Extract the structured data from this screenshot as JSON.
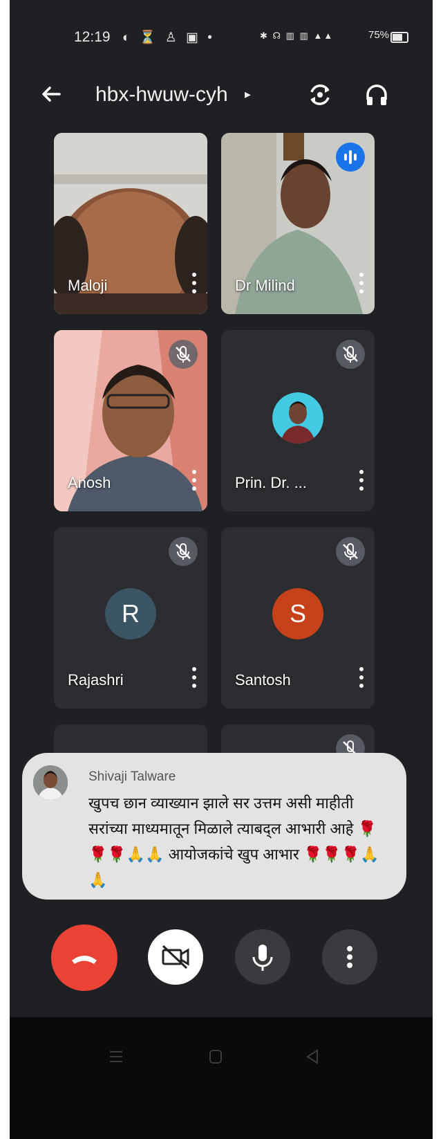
{
  "status_bar": {
    "time": "12:19",
    "battery": "75%"
  },
  "header": {
    "meeting_code": "hbx-hwuw-cyh"
  },
  "participants": [
    {
      "name": "Maloji"
    },
    {
      "name": "Dr Milind"
    },
    {
      "name": "Anosh"
    },
    {
      "name": "Prin. Dr. ..."
    },
    {
      "name": "Rajashri",
      "initial": "R"
    },
    {
      "name": "Santosh",
      "initial": "S"
    }
  ],
  "notification": {
    "sender": "Shivaji Talware",
    "message": "खुपच छान व्याख्यान झाले सर उत्तम असी माहीती सरांच्या माध्यमातून मिळाले त्याबद्ल आभारी आहे 🌹🌹🌹🙏🙏 आयोजकांचे खुप आभार 🌹🌹🌹🙏🙏"
  },
  "colors": {
    "background": "#1f2023",
    "tile": "#2c2d30",
    "end_call": "#ea4335",
    "speaking": "#1a73e8",
    "avatar_r": "#3c5564",
    "avatar_s": "#c5421a"
  }
}
